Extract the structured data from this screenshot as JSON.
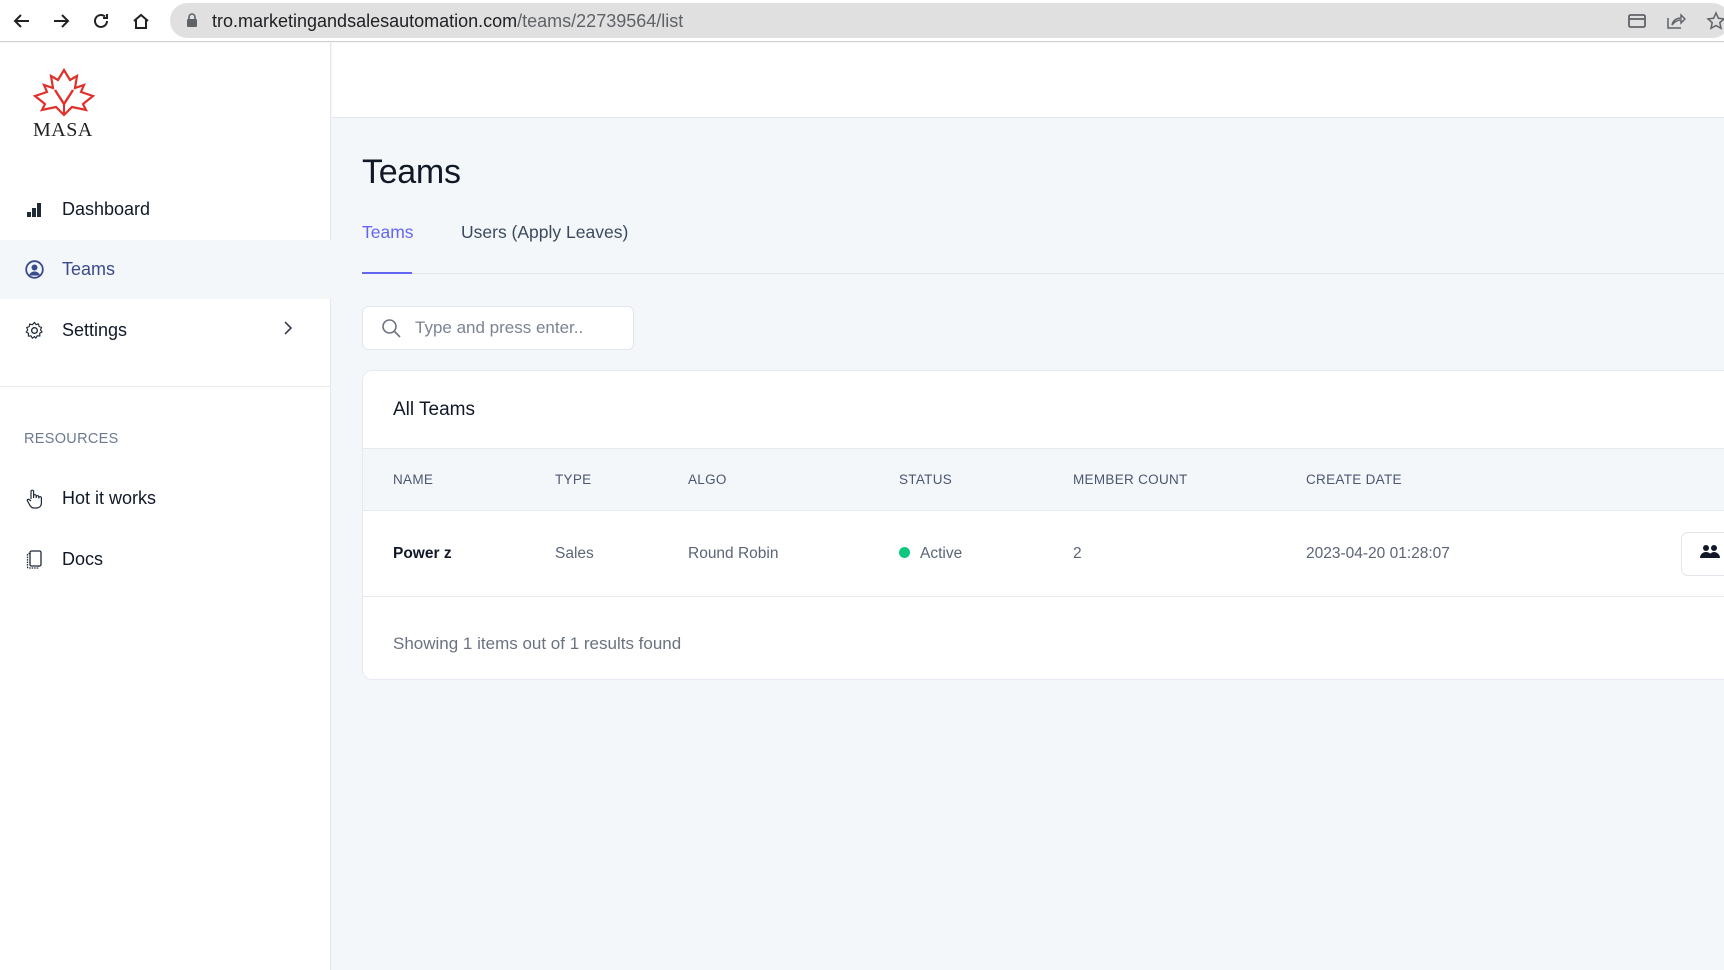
{
  "browser": {
    "url_host": "tro.marketingandsalesautomation.com",
    "url_path": "/teams/22739564/list",
    "icons": [
      "back-arrow-icon",
      "forward-arrow-icon",
      "reload-icon",
      "home-icon",
      "lock-icon",
      "tab-search-icon",
      "share-icon",
      "bookmark-star-icon"
    ]
  },
  "brand": {
    "logo_text": "MASA",
    "logo_color": "#e0302a"
  },
  "sidebar": {
    "items": [
      {
        "label": "Dashboard",
        "icon": "bar-chart-icon",
        "active": false
      },
      {
        "label": "Teams",
        "icon": "user-circle-icon",
        "active": true
      },
      {
        "label": "Settings",
        "icon": "gear-icon",
        "active": false,
        "has_submenu": true
      }
    ],
    "resources_heading": "RESOURCES",
    "resources": [
      {
        "label": "Hot it works",
        "icon": "pointer-hand-icon"
      },
      {
        "label": "Docs",
        "icon": "document-icon"
      }
    ]
  },
  "page": {
    "title": "Teams",
    "tabs": [
      {
        "label": "Teams",
        "active": true
      },
      {
        "label": "Users (Apply Leaves)",
        "active": false
      }
    ],
    "search_placeholder": "Type and press enter..",
    "search_value": ""
  },
  "table": {
    "title": "All Teams",
    "columns": [
      "NAME",
      "TYPE",
      "ALGO",
      "STATUS",
      "MEMBER COUNT",
      "CREATE DATE"
    ],
    "rows": [
      {
        "name": "Power z",
        "type": "Sales",
        "algo": "Round Robin",
        "status": "Active",
        "status_color": "#10c77f",
        "member_count": "2",
        "create_date": "2023-04-20 01:28:07",
        "action_icon": "team-members-icon"
      }
    ],
    "footer": "Showing 1 items out of 1 results found"
  },
  "colors": {
    "accent": "#6366f1",
    "active_nav": "#3b4a8a",
    "background": "#f4f7fa"
  }
}
